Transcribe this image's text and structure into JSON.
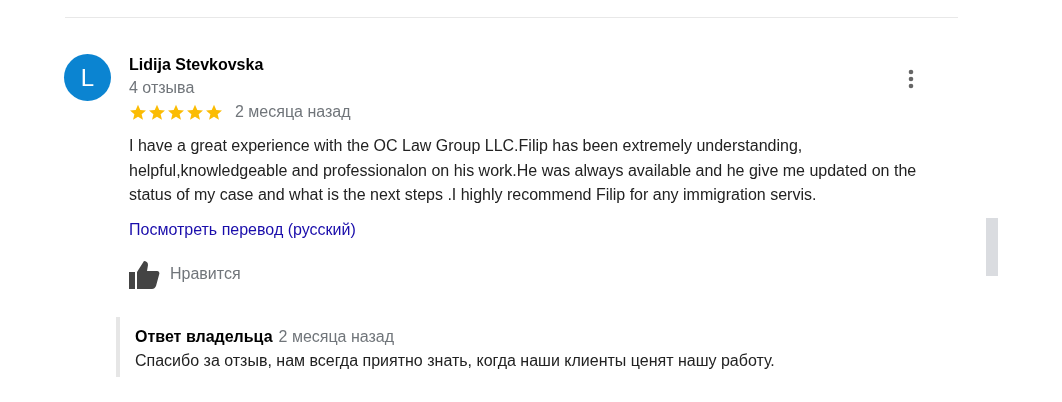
{
  "review": {
    "author": "Lidija Stevkovska",
    "avatar_letter": "L",
    "review_count": "4 отзыва",
    "stars": 5,
    "date": "2 месяца назад",
    "text": "I have a great experience with the OC Law Group LLC.Filip has been extremely understanding, helpful,knowledgeable and professionalon on his work.He was always available and he give me updated on the status of my case and what is the next steps .I highly recommend Filip for any immigration servis.",
    "translate_link": "Посмотреть перевод (русский)",
    "like_label": "Нравится",
    "owner_reply": {
      "title": "Ответ владельца",
      "date": "2 месяца назад",
      "text": "Спасибо за отзыв, нам всегда приятно знать, когда наши клиенты ценят нашу работу."
    }
  }
}
